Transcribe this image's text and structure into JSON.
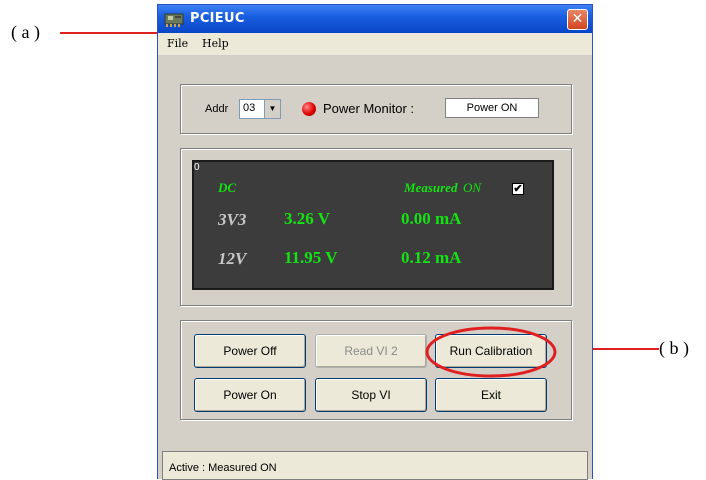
{
  "annotations": {
    "a_label": "( a )",
    "b_label": "( b )"
  },
  "window": {
    "title": "PCIEUC",
    "close_symbol": "✕"
  },
  "menu": {
    "file": "File",
    "help": "Help"
  },
  "top_panel": {
    "addr_label": "Addr",
    "addr_value": "03",
    "power_monitor_label": "Power Monitor :",
    "power_monitor_value": "Power ON",
    "led_color": "#e00000"
  },
  "display": {
    "corner_mark": "0",
    "dc_label": "DC",
    "measured_label": "Measured",
    "on_label": "ON",
    "checkbox_checked": true,
    "checkbox_mark": "✔",
    "rows": [
      {
        "name": "3V3",
        "voltage": "3.26 V",
        "current": "0.00 mA"
      },
      {
        "name": "12V",
        "voltage": "11.95 V",
        "current": "0.12 mA"
      }
    ],
    "colors": {
      "background": "#3c3c3c",
      "value": "#14e214",
      "label": "#c8c8c8"
    }
  },
  "buttons": {
    "power_off": "Power Off",
    "read_vi": "Read VI  2",
    "run_calibration": "Run Calibration",
    "power_on": "Power On",
    "stop_vi": "Stop VI",
    "exit": "Exit"
  },
  "status": {
    "text": "Active :  Measured  ON"
  }
}
